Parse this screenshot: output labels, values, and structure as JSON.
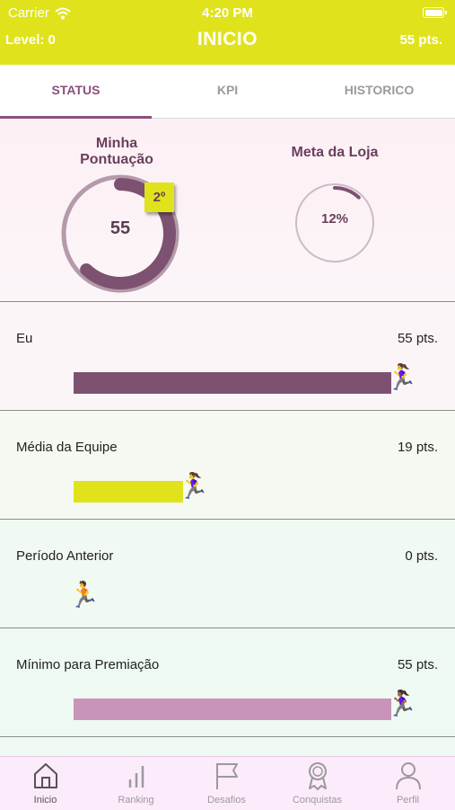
{
  "status_bar": {
    "carrier": "Carrier",
    "time": "4:20 PM"
  },
  "header": {
    "level": "Level: 0",
    "title": "INICIO",
    "points": "55 pts."
  },
  "tabs": [
    {
      "label": "STATUS",
      "active": true
    },
    {
      "label": "KPI",
      "active": false
    },
    {
      "label": "HISTORICO",
      "active": false
    }
  ],
  "status": {
    "score_title": "Minha Pontuação",
    "score": "55",
    "rank": "2º",
    "score_progress": 0.62,
    "goal_title": "Meta da Loja",
    "goal_percent": "12%",
    "goal_progress": 0.12
  },
  "rows": [
    {
      "label": "Eu",
      "points": "55 pts.",
      "progress": 1.0,
      "color": "#7d5170",
      "runner": "🏃‍♀️"
    },
    {
      "label": "Média da Equipe",
      "points": "19 pts.",
      "progress": 0.345,
      "color": "#e0e31b",
      "runner": "🏃‍♀️"
    },
    {
      "label": "Período Anterior",
      "points": "0 pts.",
      "progress": 0.0,
      "color": "#7d5170",
      "runner": "🏃"
    },
    {
      "label": "Mínimo para Premiação",
      "points": "55 pts.",
      "progress": 1.0,
      "color": "#c894b9",
      "runner": "🏃🏾‍♀️"
    }
  ],
  "tabbar": [
    {
      "label": "Inicio",
      "icon": "home-icon",
      "active": true
    },
    {
      "label": "Ranking",
      "icon": "bar-chart-icon",
      "active": false
    },
    {
      "label": "Desafios",
      "icon": "flag-icon",
      "active": false
    },
    {
      "label": "Conquistas",
      "icon": "medal-icon",
      "active": false
    },
    {
      "label": "Perfil",
      "icon": "person-icon",
      "active": false
    }
  ],
  "colors": {
    "accent": "#e0e31b",
    "primary": "#8b4f7a"
  }
}
